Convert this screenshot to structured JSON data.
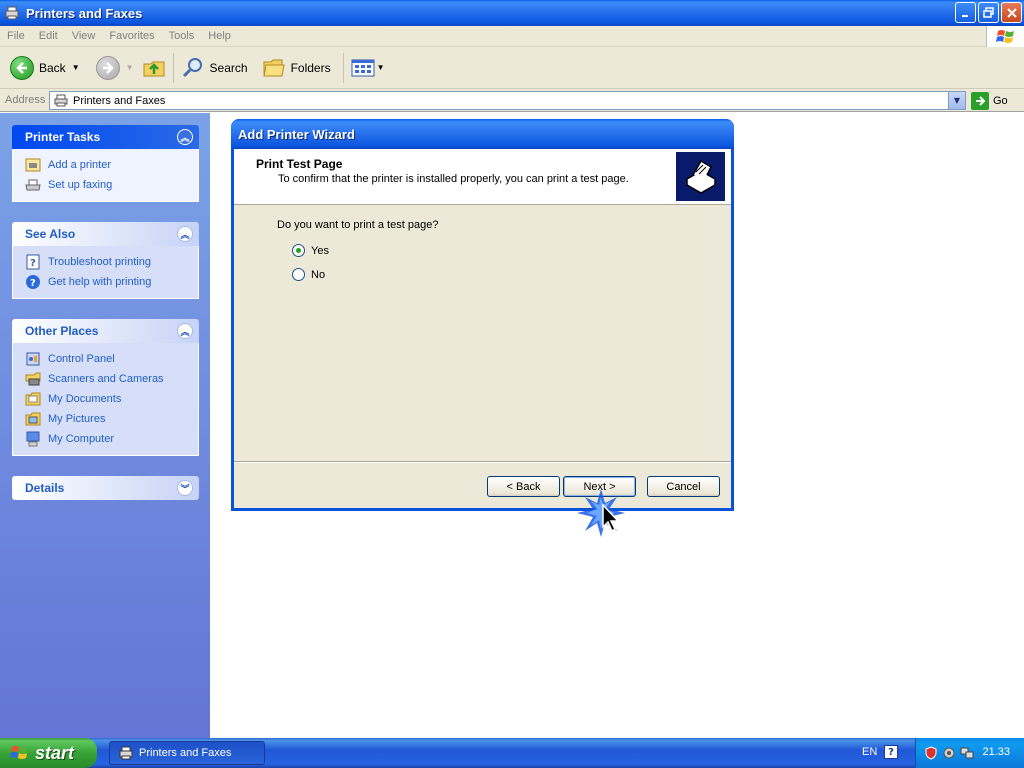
{
  "window": {
    "title": "Printers and Faxes"
  },
  "menu": [
    "File",
    "Edit",
    "View",
    "Favorites",
    "Tools",
    "Help"
  ],
  "toolbar": {
    "back_label": "Back",
    "search_label": "Search",
    "folders_label": "Folders"
  },
  "address": {
    "label": "Address",
    "value": "Printers and Faxes",
    "go_label": "Go"
  },
  "sidebar": {
    "printer_tasks": {
      "title": "Printer Tasks",
      "items": [
        "Add a printer",
        "Set up faxing"
      ]
    },
    "see_also": {
      "title": "See Also",
      "items": [
        "Troubleshoot printing",
        "Get help with printing"
      ]
    },
    "other_places": {
      "title": "Other Places",
      "items": [
        "Control Panel",
        "Scanners and Cameras",
        "My Documents",
        "My Pictures",
        "My Computer"
      ]
    },
    "details": {
      "title": "Details"
    }
  },
  "wizard": {
    "title": "Add Printer Wizard",
    "header_title": "Print Test Page",
    "header_subtitle": "To confirm that the printer is installed properly, you can print a test page.",
    "question": "Do you want to print a test page?",
    "options": [
      "Yes",
      "No"
    ],
    "selected": "Yes",
    "back_label": "< Back",
    "next_label": "Next >",
    "cancel_label": "Cancel"
  },
  "taskbar": {
    "start_label": "start",
    "task_item": "Printers and Faxes",
    "language": "EN",
    "clock": "21.33"
  },
  "colors": {
    "xp_blue": "#0a52d8",
    "link_blue": "#215dc6",
    "dialog_bg": "#ece9d8",
    "start_green": "#37a337"
  }
}
